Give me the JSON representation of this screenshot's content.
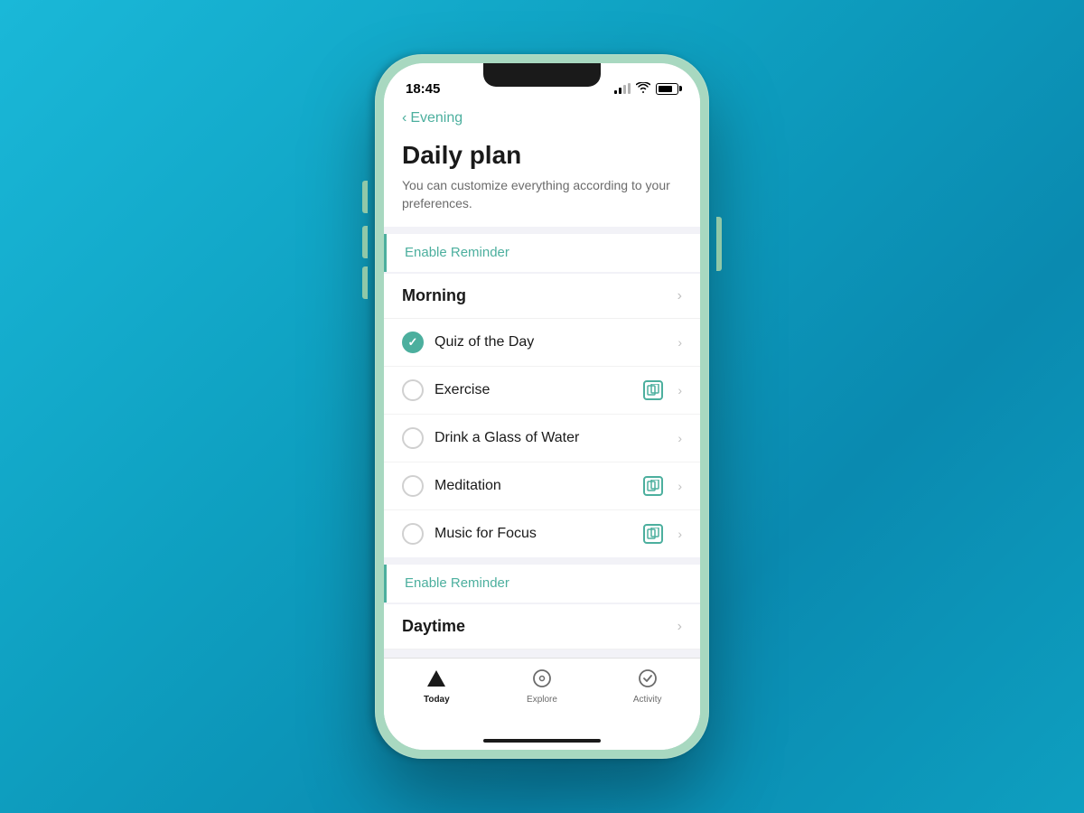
{
  "phone": {
    "statusBar": {
      "time": "18:45",
      "batteryLevel": 80
    },
    "navigation": {
      "backLabel": "Evening"
    },
    "page": {
      "title": "Daily plan",
      "subtitle": "You can customize everything according to your preferences."
    },
    "sections": [
      {
        "id": "morning",
        "enableReminderLabel": "Enable Reminder",
        "title": "Morning",
        "tasks": [
          {
            "id": "quiz",
            "name": "Quiz of the Day",
            "checked": true,
            "hasBadge": false
          },
          {
            "id": "exercise",
            "name": "Exercise",
            "checked": false,
            "hasBadge": true
          },
          {
            "id": "water",
            "name": "Drink a Glass of Water",
            "checked": false,
            "hasBadge": false
          },
          {
            "id": "meditation",
            "name": "Meditation",
            "checked": false,
            "hasBadge": true
          },
          {
            "id": "music",
            "name": "Music for Focus",
            "checked": false,
            "hasBadge": true
          }
        ]
      },
      {
        "id": "daytime",
        "enableReminderLabel": "Enable Reminder",
        "title": "Daytime",
        "tasks": []
      }
    ],
    "tabBar": {
      "tabs": [
        {
          "id": "today",
          "label": "Today",
          "active": true
        },
        {
          "id": "explore",
          "label": "Explore",
          "active": false
        },
        {
          "id": "activity",
          "label": "Activity",
          "active": false
        }
      ]
    }
  }
}
